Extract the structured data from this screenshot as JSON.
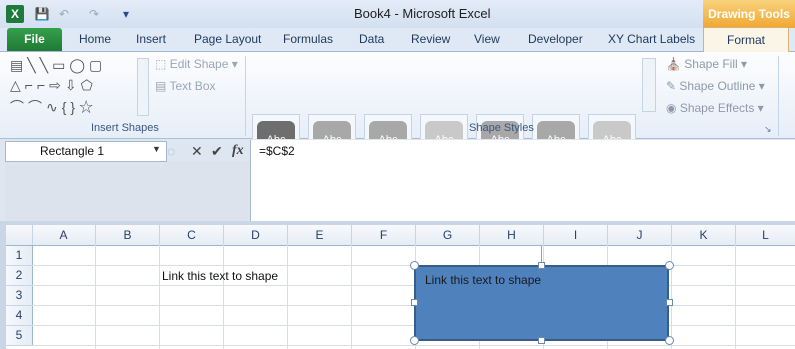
{
  "titlebar": {
    "title": "Book4  -  Microsoft Excel",
    "contextual_tab_group": "Drawing Tools",
    "app_icon": "X"
  },
  "tabs": [
    "File",
    "Home",
    "Insert",
    "Page Layout",
    "Formulas",
    "Data",
    "Review",
    "View",
    "Developer",
    "XY Chart Labels",
    "Format"
  ],
  "ribbon": {
    "insert_shapes": {
      "edit_shape": "Edit Shape",
      "text_box": "Text Box",
      "label": "Insert Shapes"
    },
    "shape_styles": {
      "sample": "Abc",
      "label": "Shape Styles",
      "fills": [
        "#6e6e6e",
        "#a8a8a8",
        "#a8a8a8",
        "#c9c9c9",
        "#a8a8a8",
        "#a8a8a8",
        "#c9c9c9"
      ],
      "shape_fill": "Shape Fill",
      "shape_outline": "Shape Outline",
      "shape_effects": "Shape Effects"
    }
  },
  "formula_bar": {
    "name_box": "Rectangle 1",
    "fx": "fx",
    "formula": "=$C$2"
  },
  "sheet": {
    "columns": [
      "A",
      "B",
      "C",
      "D",
      "E",
      "F",
      "G",
      "H",
      "I",
      "J",
      "K",
      "L"
    ],
    "rows": [
      "1",
      "2",
      "3",
      "4",
      "5"
    ],
    "cell_c2": "Link this text to shape"
  },
  "shape": {
    "text": "Link this text to shape",
    "fill": "#4f81bd"
  }
}
